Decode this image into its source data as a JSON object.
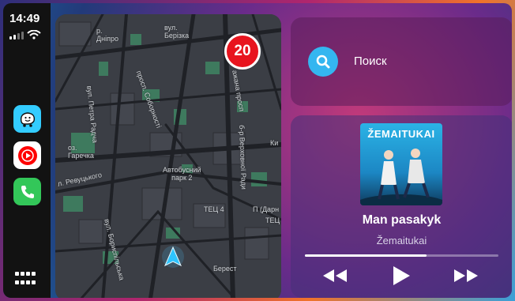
{
  "status_bar": {
    "time": "14:49"
  },
  "sidebar": {
    "apps": [
      {
        "name": "Waze",
        "icon": "waze-icon"
      },
      {
        "name": "YouTube Music",
        "icon": "youtube-music-icon"
      },
      {
        "name": "Phone",
        "icon": "phone-icon"
      }
    ],
    "app_grid_icon": "app-grid-icon"
  },
  "map": {
    "speed_limit": "20",
    "labels": {
      "dnipro": "р.\nДніпро",
      "berizka": "вул.\nБерізка",
      "soborny": "просп. Соборності",
      "pavla": "вул. Петра Радча",
      "harechka": "оз.\nГаречка",
      "revutskoho": "л. Ревуцького",
      "autobus": "Автобусний\nпарк 2",
      "tets": "ТЕЦ 4",
      "berest": "Берест",
      "boryspilska": "вул. Бориспільська",
      "virgova": "б-р Верховної Ради",
      "dary": "П (Дарн",
      "tets2": "ТЕЦ",
      "bazhana": "ажана просп",
      "ky": "Ки"
    },
    "colors": {
      "background": "#3b3e45",
      "park": "#3e7a5e",
      "road": "#1f2126"
    }
  },
  "search": {
    "label": "Поиск",
    "accent": "#34b6f0"
  },
  "now_playing": {
    "album_art_text": "ŽEMAITUKAI",
    "song": "Man pasakyk",
    "artist": "Žemaitukai",
    "progress": 0.63,
    "controls": {
      "rewind": "rewind-icon",
      "play": "play-icon",
      "forward": "fast-forward-icon"
    }
  }
}
